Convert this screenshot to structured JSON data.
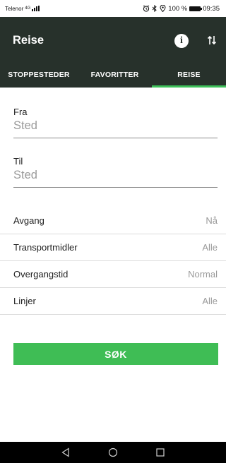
{
  "status_bar": {
    "carrier": "Telenor",
    "network": "4G",
    "battery_percent": "100 %",
    "time": "09:35"
  },
  "app_bar": {
    "title": "Reise",
    "info_icon": "info-icon",
    "swap_icon": "swap-arrows-icon"
  },
  "tabs": [
    {
      "label": "STOPPESTEDER",
      "active": false
    },
    {
      "label": "FAVORITTER",
      "active": false
    },
    {
      "label": "REISE",
      "active": true
    }
  ],
  "form": {
    "from": {
      "label": "Fra",
      "placeholder": "Sted",
      "value": ""
    },
    "to": {
      "label": "Til",
      "placeholder": "Sted",
      "value": ""
    }
  },
  "options": [
    {
      "label": "Avgang",
      "value": "Nå"
    },
    {
      "label": "Transportmidler",
      "value": "Alle"
    },
    {
      "label": "Overgangstid",
      "value": "Normal"
    },
    {
      "label": "Linjer",
      "value": "Alle"
    }
  ],
  "search_button": {
    "label": "SØK"
  },
  "colors": {
    "app_bar": "#27312b",
    "accent": "#3fbd55",
    "navigation_bar": "#000000"
  },
  "nav_bar": {
    "back_icon": "back-triangle-icon",
    "home_icon": "home-circle-icon",
    "recents_icon": "recents-square-icon"
  }
}
